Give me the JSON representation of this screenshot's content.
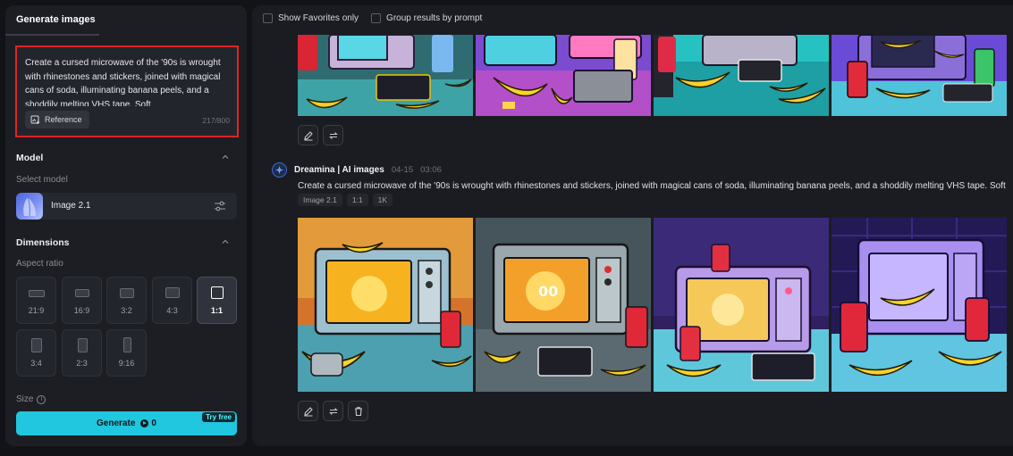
{
  "left_panel": {
    "tab_label": "Generate images",
    "prompt": {
      "text": "Create a cursed microwave of the '90s is wrought with rhinestones and stickers, joined with magical cans of soda, illuminating banana peels, and a shoddily melting VHS tape. Soft",
      "reference_label": "Reference",
      "char_count": "217/800"
    },
    "model": {
      "section_title": "Model",
      "select_label": "Select model",
      "selected": "Image 2.1"
    },
    "dimensions": {
      "section_title": "Dimensions",
      "aspect_label": "Aspect ratio",
      "ratios": [
        "21:9",
        "16:9",
        "3:2",
        "4:3",
        "1:1",
        "3:4",
        "2:3",
        "9:16"
      ],
      "selected_ratio": "1:1"
    },
    "size_label": "Size",
    "generate": {
      "label": "Generate",
      "credits": "0",
      "badge": "Try free"
    }
  },
  "results": {
    "filters": [
      "Show Favorites only",
      "Group results by prompt"
    ],
    "generation": {
      "source": "Dreamina | AI images",
      "date": "04-15",
      "time": "03:06",
      "prompt": "Create a cursed microwave of the '90s is wrought with rhinestones and stickers, joined with magical cans of soda, illuminating banana peels, and a shoddily melting VHS tape. Soft",
      "tags": [
        "Image 2.1",
        "1:1",
        "1K"
      ]
    }
  },
  "colors": {
    "accent": "#20c7de",
    "highlight_border": "#e02424"
  },
  "icons": {
    "edit": "pencil-icon",
    "regenerate": "regenerate-icon",
    "delete": "trash-icon",
    "reference": "image-upload-icon",
    "model_settings": "sliders-icon",
    "info": "info-icon"
  }
}
